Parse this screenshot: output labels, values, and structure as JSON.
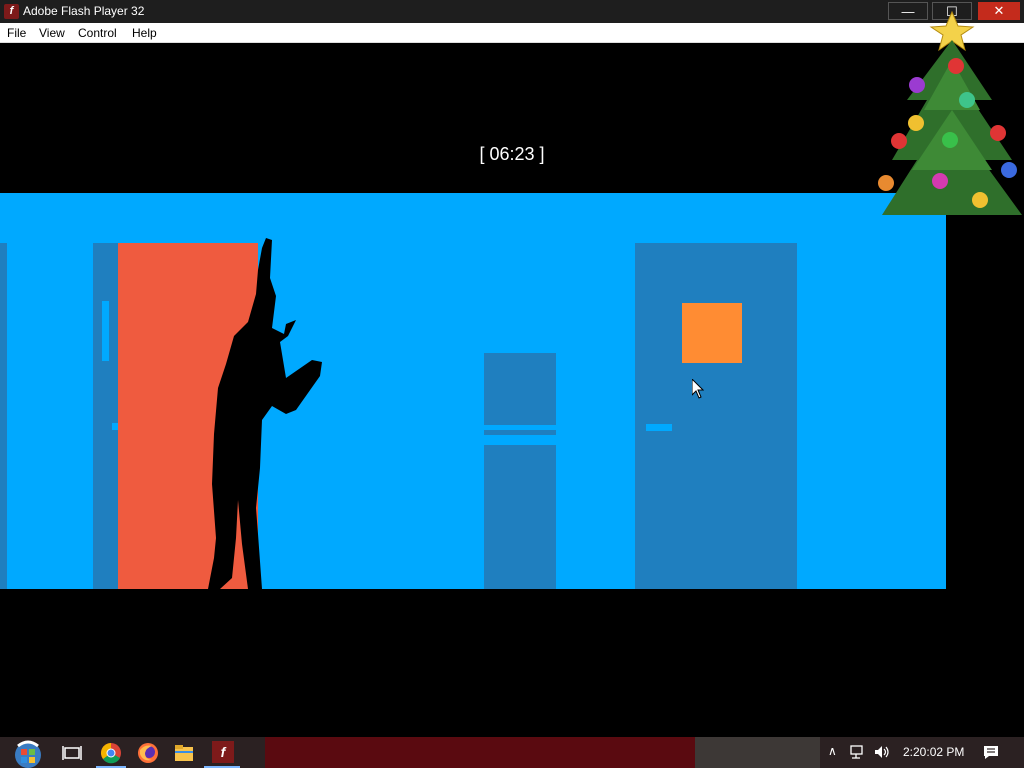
{
  "window": {
    "title": "Adobe Flash Player 32",
    "app_icon_glyph": "f",
    "minimize_glyph": "—",
    "maximize_glyph": "☐",
    "close_glyph": "✕"
  },
  "menu": {
    "items": [
      "File",
      "View",
      "Control",
      "Help"
    ]
  },
  "game": {
    "timer": "[ 06:23 ]"
  },
  "taskbar": {
    "clock": "2:20:02 PM",
    "tray_icons": [
      "chevron-up-icon",
      "network-icon",
      "volume-icon",
      "notification-icon"
    ],
    "pinned": [
      "task-view-icon",
      "chrome-icon",
      "firefox-icon",
      "file-explorer-icon",
      "flash-player-icon"
    ]
  },
  "colors": {
    "scene_bg": "#00a9ff",
    "door": "#1f7fbf",
    "red_door": "#ef5b3f",
    "orange": "#ff8c33"
  }
}
